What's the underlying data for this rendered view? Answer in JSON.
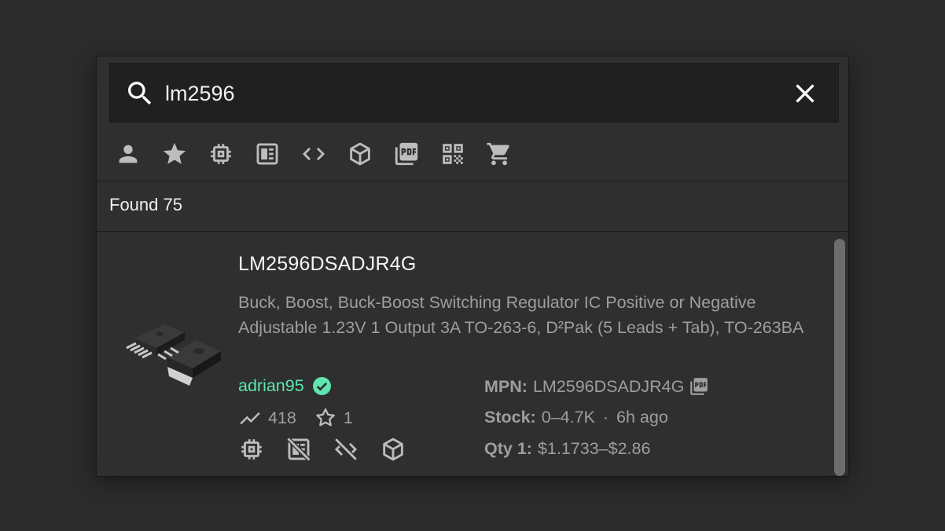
{
  "search": {
    "value": "lm2596",
    "placeholder": ""
  },
  "filters": [
    {
      "icon": "person-icon"
    },
    {
      "icon": "star-icon"
    },
    {
      "icon": "chip-icon"
    },
    {
      "icon": "footprint-icon"
    },
    {
      "icon": "code-icon"
    },
    {
      "icon": "cube-icon"
    },
    {
      "icon": "pdf-icon"
    },
    {
      "icon": "qr-code-icon"
    },
    {
      "icon": "cart-icon"
    }
  ],
  "results": {
    "found_label": "Found 75"
  },
  "part": {
    "title": "LM2596DSADJR4G",
    "description": "Buck, Boost, Buck-Boost Switching Regulator IC Positive or Negative Adjustable 1.23V 1 Output 3A TO-263-6, D²Pak (5 Leads + Tab), TO-263BA",
    "author": "adrian95",
    "downloads": "418",
    "stars": "1",
    "mpn_label": "MPN:",
    "mpn_value": "LM2596DSADJR4G",
    "stock_label": "Stock:",
    "stock_value": "0–4.7K",
    "stock_sep": "·",
    "stock_age": "6h ago",
    "qty_label": "Qty 1:",
    "qty_value": "$1.1733–$2.86"
  },
  "colors": {
    "accent": "#5ee6b0",
    "icon": "#bdbdbd",
    "text_muted": "#9e9e9e"
  }
}
